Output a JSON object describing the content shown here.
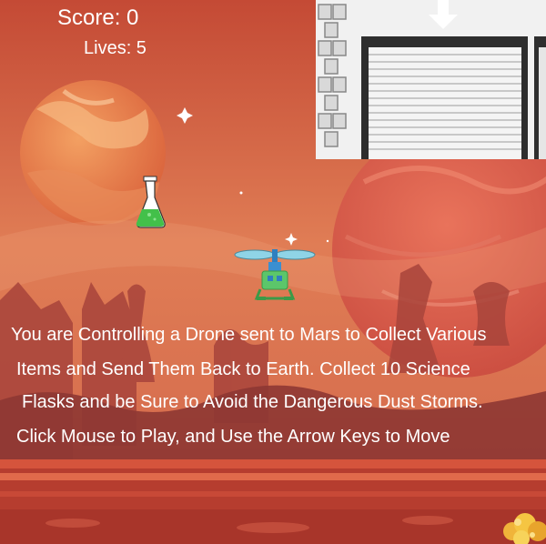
{
  "hud": {
    "score_label": "Score: 0",
    "lives_label": "Lives: 5"
  },
  "instructions": {
    "lines": [
      "You are Controlling a Drone sent to Mars to Collect Various",
      "Items and Send Them Back to Earth. Collect 10 Science",
      "Flasks and be Sure to Avoid the Dangerous Dust Storms.",
      "Click Mouse to Play, and Use the Arrow Keys to Move"
    ]
  },
  "icons": {
    "drone": "drone-icon",
    "flask": "science-flask-icon",
    "base": "earth-base-garage-icon",
    "arrow": "down-arrow-icon",
    "planet": "planet-icon",
    "dust": "dust-storm-icon"
  },
  "colors": {
    "sky": "#d86a4c",
    "ground": "#b83a2e",
    "text": "#ffffff",
    "drone_body": "#5cc66a",
    "drone_rotor": "#8fd4e6",
    "flask_liquid": "#43c04a"
  }
}
